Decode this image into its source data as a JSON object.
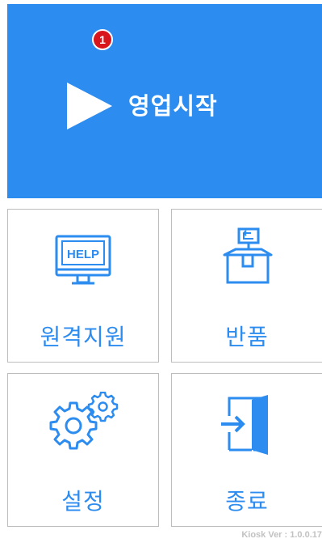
{
  "start_panel": {
    "badge": "1",
    "label": "영업시작",
    "icon": "play-icon"
  },
  "tiles": [
    {
      "label": "원격지원",
      "icon": "help-monitor-icon",
      "icon_text": "HELP"
    },
    {
      "label": "반품",
      "icon": "return-box-icon"
    },
    {
      "label": "설정",
      "icon": "gears-icon"
    },
    {
      "label": "종료",
      "icon": "exit-door-icon"
    }
  ],
  "version": "Kiosk Ver : 1.0.0.17",
  "colors": {
    "accent": "#2d8cf0",
    "badge": "#d9161b",
    "border": "#bdbdbd",
    "version_text": "#c2c2c2"
  }
}
